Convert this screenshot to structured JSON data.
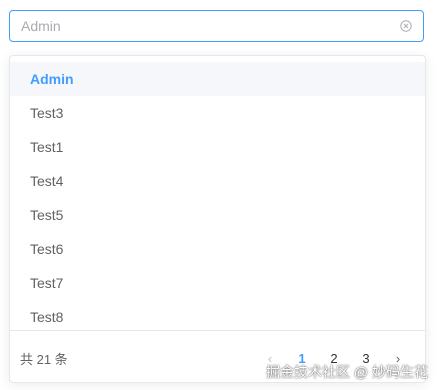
{
  "select": {
    "placeholder": "Admin",
    "value": ""
  },
  "options": [
    {
      "label": "Admin",
      "selected": true
    },
    {
      "label": "Test3",
      "selected": false
    },
    {
      "label": "Test1",
      "selected": false
    },
    {
      "label": "Test4",
      "selected": false
    },
    {
      "label": "Test5",
      "selected": false
    },
    {
      "label": "Test6",
      "selected": false
    },
    {
      "label": "Test7",
      "selected": false
    },
    {
      "label": "Test8",
      "selected": false
    }
  ],
  "pagination": {
    "total_text": "共 21 条",
    "prev_icon": "‹",
    "next_icon": "›",
    "pages": [
      "1",
      "2",
      "3"
    ],
    "current_page": "1"
  },
  "watermark": "掘金技术社区 @ 妙码生花",
  "colors": {
    "accent": "#409eff",
    "text": "#606266",
    "border": "#e4e7ed",
    "hover_bg": "#f5f7fa"
  }
}
